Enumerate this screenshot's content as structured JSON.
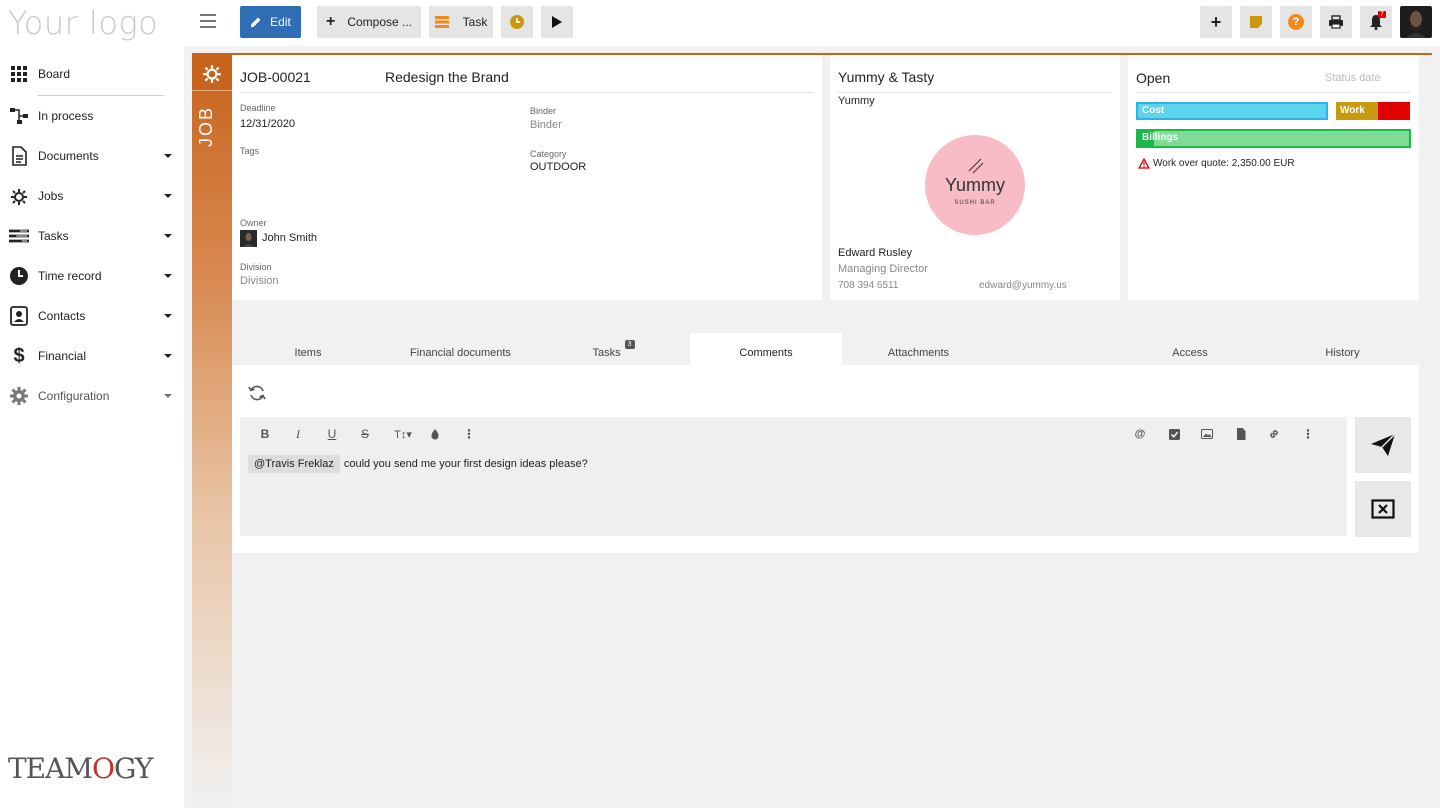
{
  "brand": {
    "logo_text": "Your logo",
    "footer_logo": "TEAMOGY"
  },
  "sidebar": {
    "items": [
      {
        "label": "Board"
      },
      {
        "label": "In process"
      },
      {
        "label": "Documents"
      },
      {
        "label": "Jobs"
      },
      {
        "label": "Tasks"
      },
      {
        "label": "Time record"
      },
      {
        "label": "Contacts"
      },
      {
        "label": "Financial"
      },
      {
        "label": "Configuration"
      }
    ]
  },
  "toolbar": {
    "edit_label": "Edit",
    "compose_label": "Compose ...",
    "task_label": "Task",
    "notification_count": "7"
  },
  "job": {
    "strip_label": "JOB",
    "number": "JOB-00021",
    "title": "Redesign the Brand",
    "deadline_label": "Deadline",
    "deadline": "12/31/2020",
    "binder_label": "Binder",
    "binder_value": "Binder",
    "tags_label": "Tags",
    "category_label": "Category",
    "category_value": "OUTDOOR",
    "owner_label": "Owner",
    "owner_name": "John Smith",
    "division_label": "Division",
    "division_value": "Division"
  },
  "client": {
    "name": "Yummy & Tasty",
    "short": "Yummy",
    "logo_text": "Yummy",
    "logo_sub": "SUSHI BAR",
    "contact_name": "Edward Rusley",
    "contact_role": "Managing Director",
    "phone": "708 394 6511",
    "email": "edward@yummy.us"
  },
  "status": {
    "state": "Open",
    "date_placeholder": "Status date",
    "cost_label": "Cost",
    "work_label": "Work",
    "billings_label": "Billings",
    "billings_fill": 0.06,
    "warning": "Work over quote: 2,350.00 EUR"
  },
  "tabs": [
    {
      "label": "Items"
    },
    {
      "label": "Financial documents"
    },
    {
      "label": "Tasks",
      "badge": "3"
    },
    {
      "label": "Comments"
    },
    {
      "label": "Attachments"
    },
    {
      "label": "Access"
    },
    {
      "label": "History"
    }
  ],
  "comment": {
    "mention": "@Travis Freklaz",
    "text": "could you send me your first design ideas please?"
  },
  "colors": {
    "accent": "#c8631e",
    "edit_button": "#2f6db5",
    "cost_bar": "#5bd5ef",
    "work_bar": "#c99a0e",
    "work_over": "#e00000",
    "billings_bar": "#7fdb95",
    "billings_fill": "#1db84a"
  }
}
